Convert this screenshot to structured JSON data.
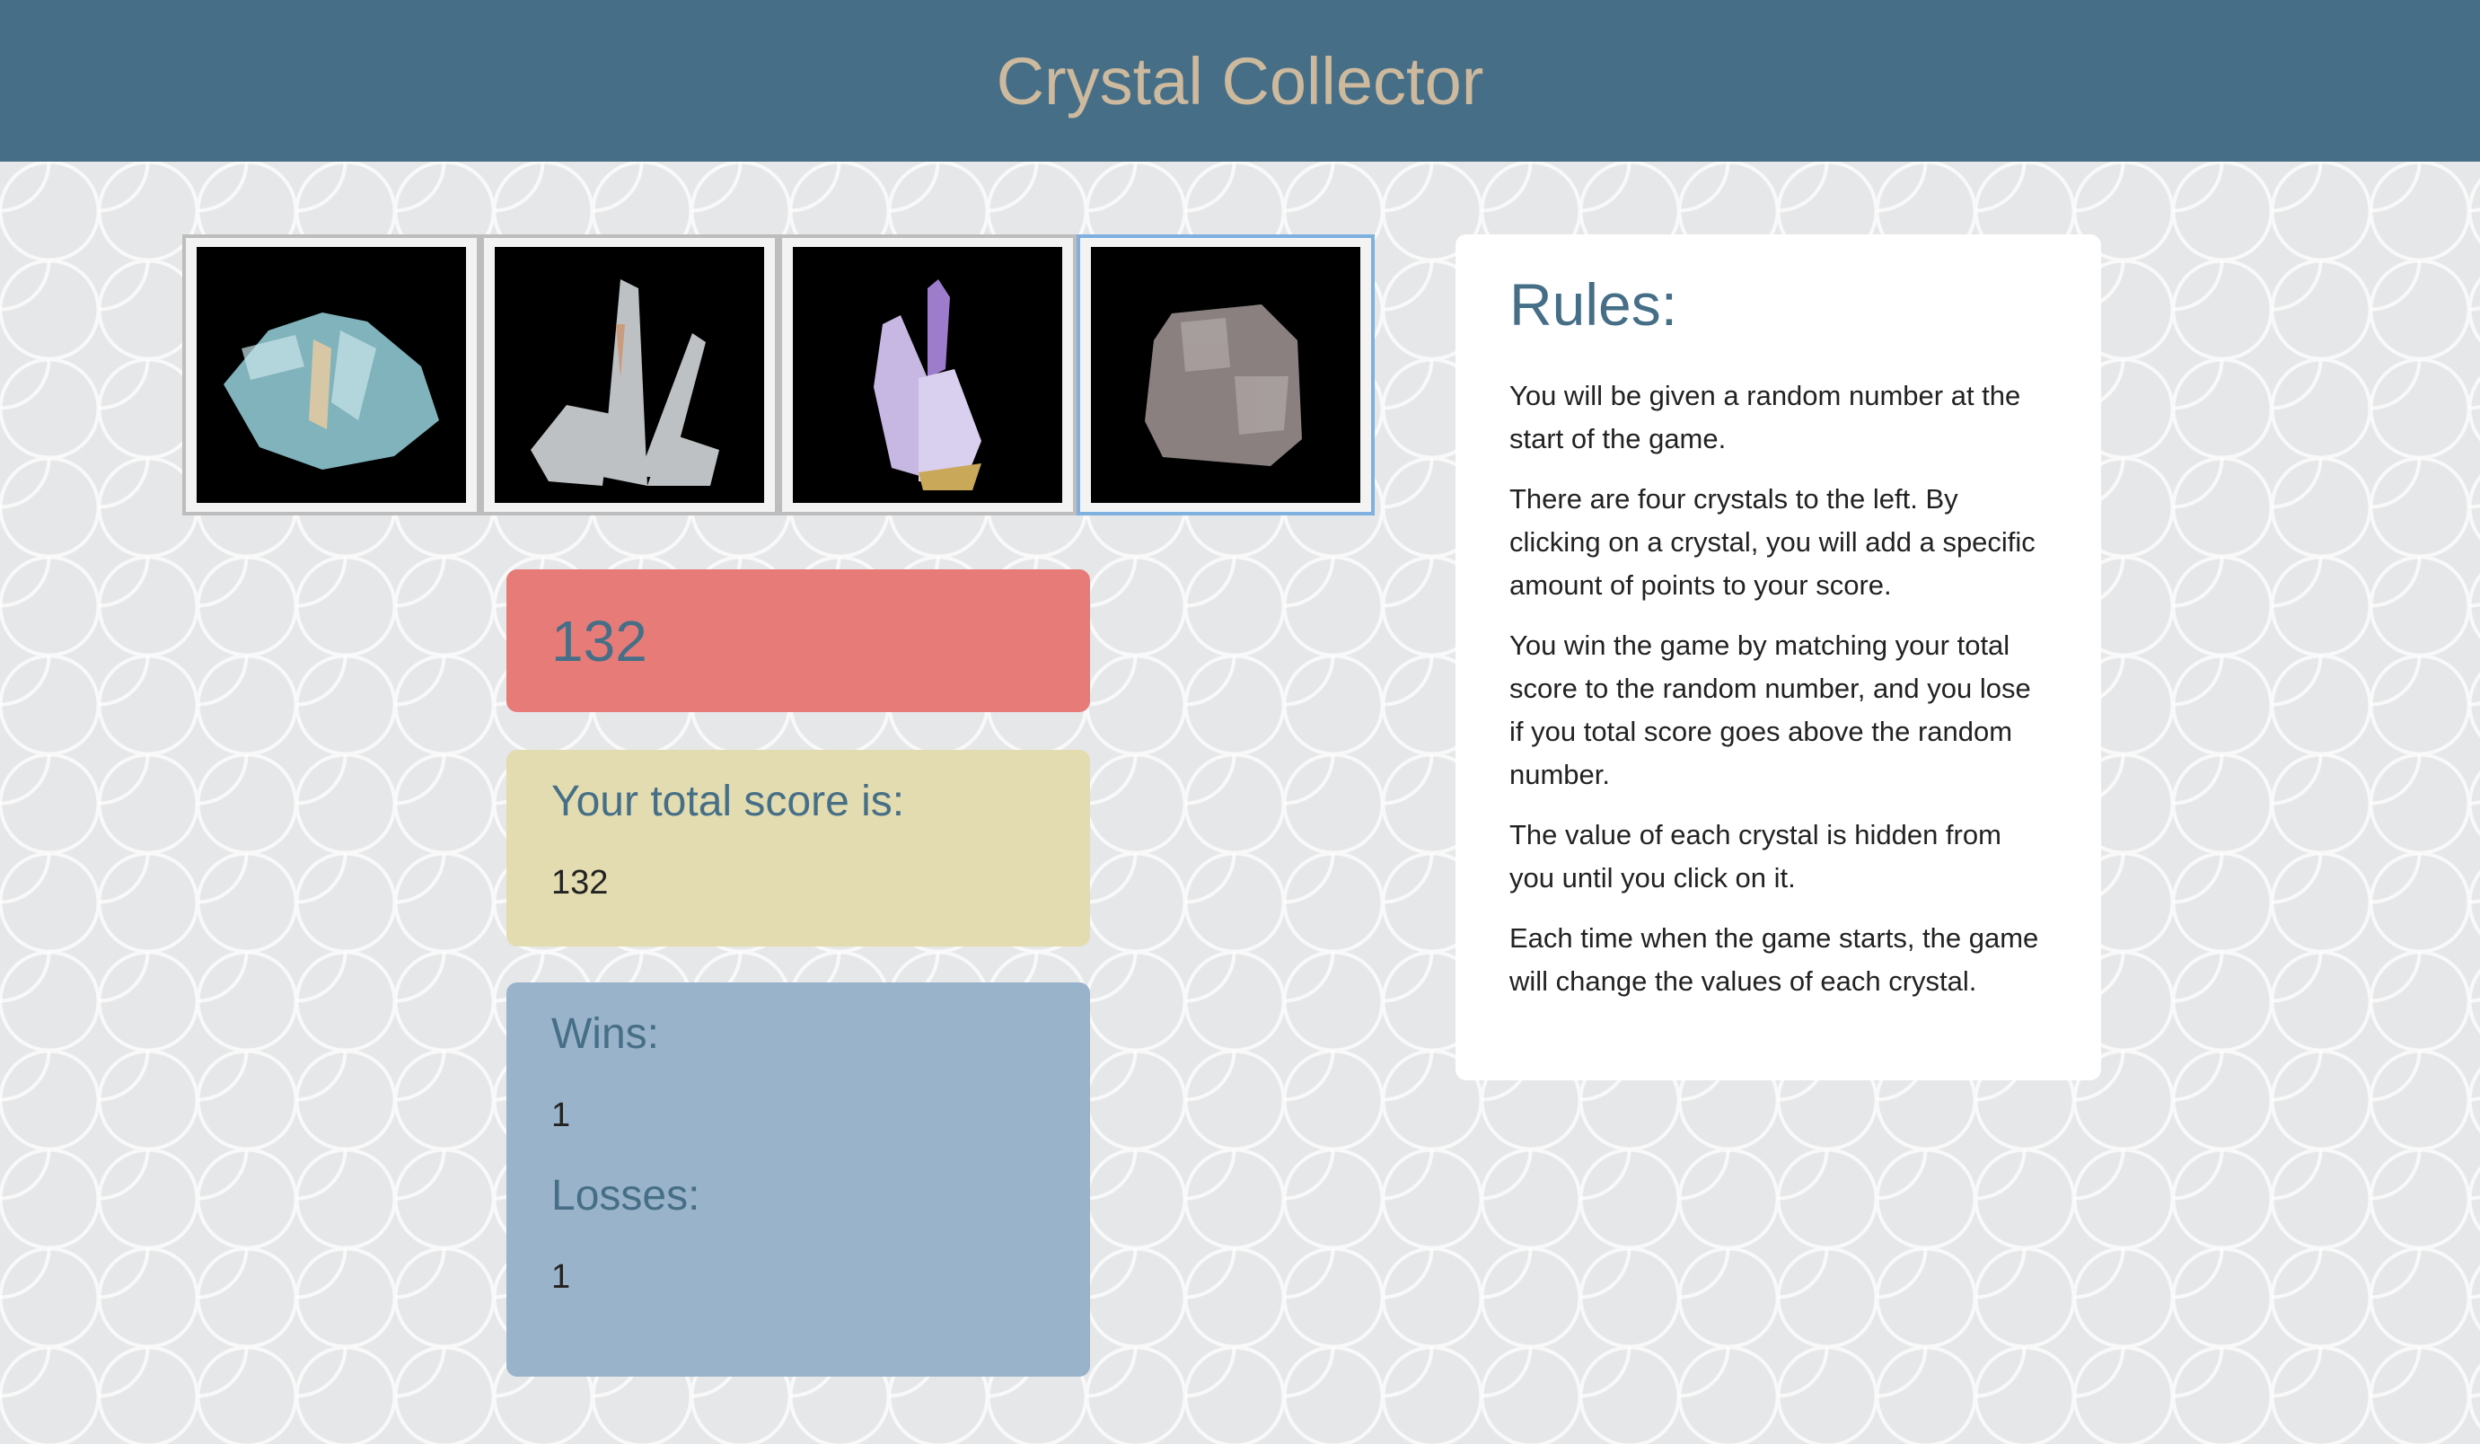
{
  "header": {
    "title": "Crystal Collector"
  },
  "crystals": [
    {
      "name": "aquamarine",
      "color": "#8fc7d0"
    },
    {
      "name": "quartz",
      "color": "#d9dde0"
    },
    {
      "name": "amethyst",
      "color": "#b7a2d6"
    },
    {
      "name": "fluorite",
      "color": "#8a8080"
    }
  ],
  "game": {
    "random_number": "132",
    "score_label": "Your total score is:",
    "score": "132",
    "wins_label": "Wins:",
    "wins": "1",
    "losses_label": "Losses:",
    "losses": "1"
  },
  "rules": {
    "title": "Rules:",
    "paragraphs": [
      "You will be given a random number at the start of the game.",
      "There are four crystals to the left. By clicking on a crystal, you will add a specific amount of points to your score.",
      "You win the game by matching your total score to the random number, and you lose if you total score goes above the random number.",
      "The value of each crystal is hidden from you until you click on it.",
      "Each time when the game starts, the game will change the values of each crystal."
    ]
  }
}
